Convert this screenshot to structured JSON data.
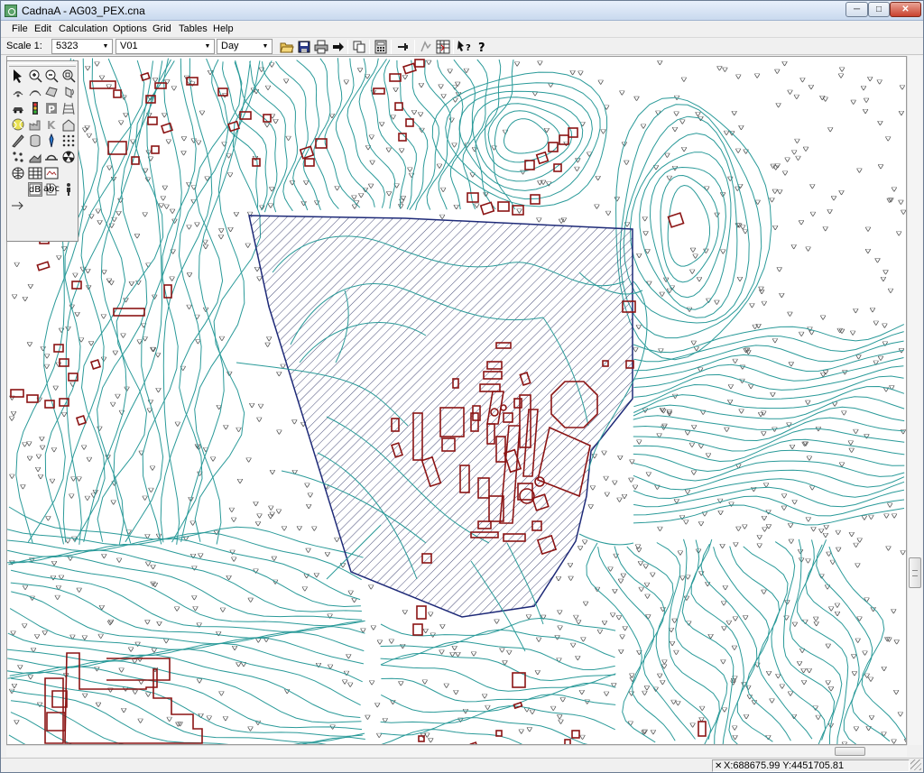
{
  "window": {
    "title": "CadnaA - AG03_PEX.cna"
  },
  "caption_buttons": {
    "minimize": "─",
    "maximize": "□",
    "close": "✕"
  },
  "menu": [
    {
      "label": "File",
      "key": "F"
    },
    {
      "label": "Edit",
      "key": "E"
    },
    {
      "label": "Calculation",
      "key": "C"
    },
    {
      "label": "Options",
      "key": "O"
    },
    {
      "label": "Grid",
      "key": "G"
    },
    {
      "label": "Tables",
      "key": "T"
    },
    {
      "label": "Help",
      "key": "H"
    }
  ],
  "toolbar": {
    "scale_label": "Scale 1:",
    "scale_value": "5323",
    "variant_value": "V01",
    "period_value": "Day",
    "combo_arrow": "▼",
    "icons": [
      "open-icon",
      "save-icon",
      "print-icon",
      "forward-arrow-icon",
      "copy-icon",
      "calculator-icon",
      "pin-icon",
      "grid-icon",
      "context-help-icon",
      "help-icon"
    ]
  },
  "palette": {
    "text_tool_label": "abc",
    "level_tool_label": "dB",
    "tools": [
      "select-arrow-icon",
      "zoom-in-icon",
      "zoom-out-icon",
      "zoom-fit-icon",
      "point-source-icon",
      "line-source-icon",
      "area-source-icon",
      "vertical-area-source-icon",
      "road-icon",
      "traffic-light-icon",
      "parking-icon",
      "railway-icon",
      "tennis-ball-icon",
      "industrial-building-icon",
      "k-tool-icon",
      "building-icon",
      "barrier-icon",
      "cylinder-icon",
      "receiver-icon",
      "grid-calc-icon",
      "contour-icon",
      "ground-absorption-icon",
      "bridge-icon",
      "radiation-icon",
      "globe-icon",
      "table-icon",
      "map-icon",
      "level-table-icon",
      "text-icon",
      "box-icon",
      "search-icon",
      "person-icon",
      "arrow-icon"
    ]
  },
  "status": {
    "coordinates": "X:688675.99 Y:4451705.81"
  },
  "colors": {
    "contour": "#2a9a99",
    "building": "#8b1414",
    "area_boundary": "#1e2a78",
    "hatch": "#4a4f7a",
    "title_gradient_top": "#e8f0fb",
    "title_gradient_bottom": "#c9d9ee"
  }
}
